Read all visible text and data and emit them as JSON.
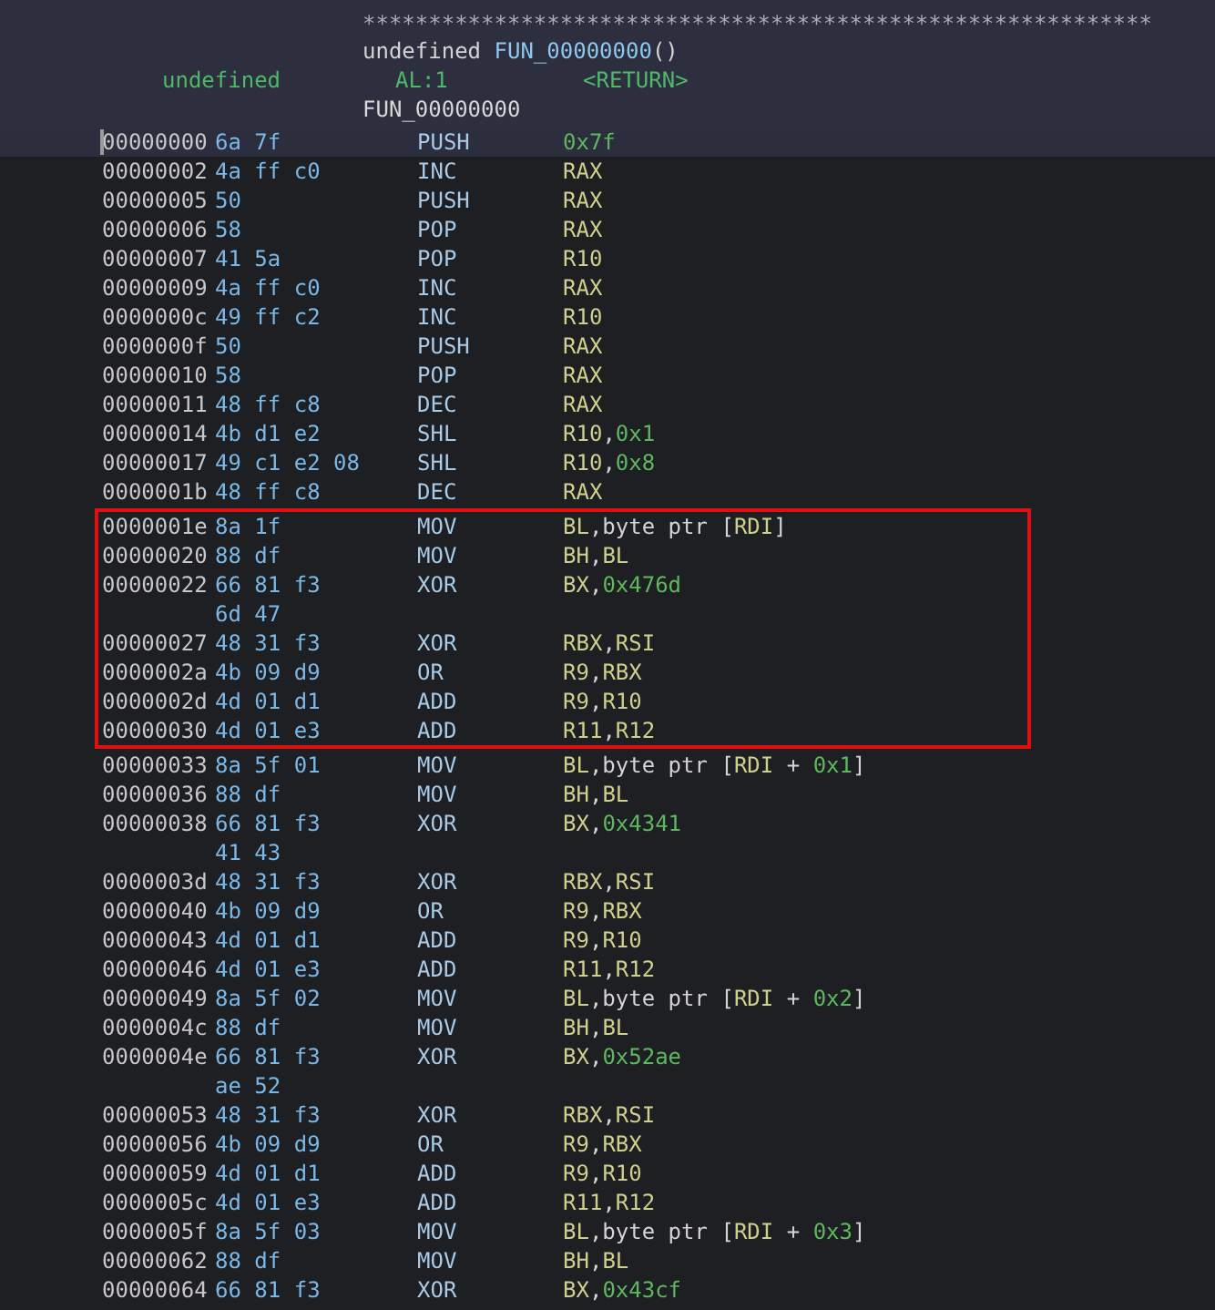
{
  "header": {
    "rule": "************************************************************",
    "signature": [
      {
        "t": "undefined ",
        "kind": "plain"
      },
      {
        "t": "FUN_00000000",
        "kind": "func"
      },
      {
        "t": "()",
        "kind": "plain"
      }
    ],
    "return_type": "undefined",
    "return_storage": "AL:1",
    "return_name": "<RETURN>",
    "label": "FUN_00000000"
  },
  "rows": [
    {
      "address": "00000000",
      "bytes": "6a 7f",
      "mnemonic": "PUSH",
      "operands": [
        {
          "t": "0x7f",
          "kind": "num"
        }
      ],
      "selected": true,
      "boxed": false
    },
    {
      "address": "00000002",
      "bytes": "4a ff c0",
      "mnemonic": "INC",
      "operands": [
        {
          "t": "RAX",
          "kind": "reg"
        }
      ],
      "selected": false,
      "boxed": false
    },
    {
      "address": "00000005",
      "bytes": "50",
      "mnemonic": "PUSH",
      "operands": [
        {
          "t": "RAX",
          "kind": "reg"
        }
      ],
      "selected": false,
      "boxed": false
    },
    {
      "address": "00000006",
      "bytes": "58",
      "mnemonic": "POP",
      "operands": [
        {
          "t": "RAX",
          "kind": "reg"
        }
      ],
      "selected": false,
      "boxed": false
    },
    {
      "address": "00000007",
      "bytes": "41 5a",
      "mnemonic": "POP",
      "operands": [
        {
          "t": "R10",
          "kind": "reg"
        }
      ],
      "selected": false,
      "boxed": false
    },
    {
      "address": "00000009",
      "bytes": "4a ff c0",
      "mnemonic": "INC",
      "operands": [
        {
          "t": "RAX",
          "kind": "reg"
        }
      ],
      "selected": false,
      "boxed": false
    },
    {
      "address": "0000000c",
      "bytes": "49 ff c2",
      "mnemonic": "INC",
      "operands": [
        {
          "t": "R10",
          "kind": "reg"
        }
      ],
      "selected": false,
      "boxed": false
    },
    {
      "address": "0000000f",
      "bytes": "50",
      "mnemonic": "PUSH",
      "operands": [
        {
          "t": "RAX",
          "kind": "reg"
        }
      ],
      "selected": false,
      "boxed": false
    },
    {
      "address": "00000010",
      "bytes": "58",
      "mnemonic": "POP",
      "operands": [
        {
          "t": "RAX",
          "kind": "reg"
        }
      ],
      "selected": false,
      "boxed": false
    },
    {
      "address": "00000011",
      "bytes": "48 ff c8",
      "mnemonic": "DEC",
      "operands": [
        {
          "t": "RAX",
          "kind": "reg"
        }
      ],
      "selected": false,
      "boxed": false
    },
    {
      "address": "00000014",
      "bytes": "4b d1 e2",
      "mnemonic": "SHL",
      "operands": [
        {
          "t": "R10",
          "kind": "reg"
        },
        {
          "t": ",",
          "kind": "plain"
        },
        {
          "t": "0x1",
          "kind": "num"
        }
      ],
      "selected": false,
      "boxed": false
    },
    {
      "address": "00000017",
      "bytes": "49 c1 e2 08",
      "mnemonic": "SHL",
      "operands": [
        {
          "t": "R10",
          "kind": "reg"
        },
        {
          "t": ",",
          "kind": "plain"
        },
        {
          "t": "0x8",
          "kind": "num"
        }
      ],
      "selected": false,
      "boxed": false
    },
    {
      "address": "0000001b",
      "bytes": "48 ff c8",
      "mnemonic": "DEC",
      "operands": [
        {
          "t": "RAX",
          "kind": "reg"
        }
      ],
      "selected": false,
      "boxed": false
    },
    {
      "address": "0000001e",
      "bytes": "8a 1f",
      "mnemonic": "MOV",
      "operands": [
        {
          "t": "BL",
          "kind": "reg"
        },
        {
          "t": ",byte ptr [",
          "kind": "plain"
        },
        {
          "t": "RDI",
          "kind": "reg"
        },
        {
          "t": "]",
          "kind": "plain"
        }
      ],
      "selected": false,
      "boxed": true
    },
    {
      "address": "00000020",
      "bytes": "88 df",
      "mnemonic": "MOV",
      "operands": [
        {
          "t": "BH",
          "kind": "reg"
        },
        {
          "t": ",",
          "kind": "plain"
        },
        {
          "t": "BL",
          "kind": "reg"
        }
      ],
      "selected": false,
      "boxed": true
    },
    {
      "address": "00000022",
      "bytes": "66 81 f3",
      "bytes_more": "6d 47",
      "mnemonic": "XOR",
      "operands": [
        {
          "t": "BX",
          "kind": "reg"
        },
        {
          "t": ",",
          "kind": "plain"
        },
        {
          "t": "0x476d",
          "kind": "num"
        }
      ],
      "selected": false,
      "boxed": true
    },
    {
      "address": "00000027",
      "bytes": "48 31 f3",
      "mnemonic": "XOR",
      "operands": [
        {
          "t": "RBX",
          "kind": "reg"
        },
        {
          "t": ",",
          "kind": "plain"
        },
        {
          "t": "RSI",
          "kind": "reg"
        }
      ],
      "selected": false,
      "boxed": true
    },
    {
      "address": "0000002a",
      "bytes": "4b 09 d9",
      "mnemonic": "OR",
      "operands": [
        {
          "t": "R9",
          "kind": "reg"
        },
        {
          "t": ",",
          "kind": "plain"
        },
        {
          "t": "RBX",
          "kind": "reg"
        }
      ],
      "selected": false,
      "boxed": true
    },
    {
      "address": "0000002d",
      "bytes": "4d 01 d1",
      "mnemonic": "ADD",
      "operands": [
        {
          "t": "R9",
          "kind": "reg"
        },
        {
          "t": ",",
          "kind": "plain"
        },
        {
          "t": "R10",
          "kind": "reg"
        }
      ],
      "selected": false,
      "boxed": true
    },
    {
      "address": "00000030",
      "bytes": "4d 01 e3",
      "mnemonic": "ADD",
      "operands": [
        {
          "t": "R11",
          "kind": "reg"
        },
        {
          "t": ",",
          "kind": "plain"
        },
        {
          "t": "R12",
          "kind": "reg"
        }
      ],
      "selected": false,
      "boxed": true
    },
    {
      "address": "00000033",
      "bytes": "8a 5f 01",
      "mnemonic": "MOV",
      "operands": [
        {
          "t": "BL",
          "kind": "reg"
        },
        {
          "t": ",byte ptr [",
          "kind": "plain"
        },
        {
          "t": "RDI",
          "kind": "reg"
        },
        {
          "t": " + ",
          "kind": "plain"
        },
        {
          "t": "0x1",
          "kind": "num"
        },
        {
          "t": "]",
          "kind": "plain"
        }
      ],
      "selected": false,
      "boxed": false
    },
    {
      "address": "00000036",
      "bytes": "88 df",
      "mnemonic": "MOV",
      "operands": [
        {
          "t": "BH",
          "kind": "reg"
        },
        {
          "t": ",",
          "kind": "plain"
        },
        {
          "t": "BL",
          "kind": "reg"
        }
      ],
      "selected": false,
      "boxed": false
    },
    {
      "address": "00000038",
      "bytes": "66 81 f3",
      "bytes_more": "41 43",
      "mnemonic": "XOR",
      "operands": [
        {
          "t": "BX",
          "kind": "reg"
        },
        {
          "t": ",",
          "kind": "plain"
        },
        {
          "t": "0x4341",
          "kind": "num"
        }
      ],
      "selected": false,
      "boxed": false
    },
    {
      "address": "0000003d",
      "bytes": "48 31 f3",
      "mnemonic": "XOR",
      "operands": [
        {
          "t": "RBX",
          "kind": "reg"
        },
        {
          "t": ",",
          "kind": "plain"
        },
        {
          "t": "RSI",
          "kind": "reg"
        }
      ],
      "selected": false,
      "boxed": false
    },
    {
      "address": "00000040",
      "bytes": "4b 09 d9",
      "mnemonic": "OR",
      "operands": [
        {
          "t": "R9",
          "kind": "reg"
        },
        {
          "t": ",",
          "kind": "plain"
        },
        {
          "t": "RBX",
          "kind": "reg"
        }
      ],
      "selected": false,
      "boxed": false
    },
    {
      "address": "00000043",
      "bytes": "4d 01 d1",
      "mnemonic": "ADD",
      "operands": [
        {
          "t": "R9",
          "kind": "reg"
        },
        {
          "t": ",",
          "kind": "plain"
        },
        {
          "t": "R10",
          "kind": "reg"
        }
      ],
      "selected": false,
      "boxed": false
    },
    {
      "address": "00000046",
      "bytes": "4d 01 e3",
      "mnemonic": "ADD",
      "operands": [
        {
          "t": "R11",
          "kind": "reg"
        },
        {
          "t": ",",
          "kind": "plain"
        },
        {
          "t": "R12",
          "kind": "reg"
        }
      ],
      "selected": false,
      "boxed": false
    },
    {
      "address": "00000049",
      "bytes": "8a 5f 02",
      "mnemonic": "MOV",
      "operands": [
        {
          "t": "BL",
          "kind": "reg"
        },
        {
          "t": ",byte ptr [",
          "kind": "plain"
        },
        {
          "t": "RDI",
          "kind": "reg"
        },
        {
          "t": " + ",
          "kind": "plain"
        },
        {
          "t": "0x2",
          "kind": "num"
        },
        {
          "t": "]",
          "kind": "plain"
        }
      ],
      "selected": false,
      "boxed": false
    },
    {
      "address": "0000004c",
      "bytes": "88 df",
      "mnemonic": "MOV",
      "operands": [
        {
          "t": "BH",
          "kind": "reg"
        },
        {
          "t": ",",
          "kind": "plain"
        },
        {
          "t": "BL",
          "kind": "reg"
        }
      ],
      "selected": false,
      "boxed": false
    },
    {
      "address": "0000004e",
      "bytes": "66 81 f3",
      "bytes_more": "ae 52",
      "mnemonic": "XOR",
      "operands": [
        {
          "t": "BX",
          "kind": "reg"
        },
        {
          "t": ",",
          "kind": "plain"
        },
        {
          "t": "0x52ae",
          "kind": "num"
        }
      ],
      "selected": false,
      "boxed": false
    },
    {
      "address": "00000053",
      "bytes": "48 31 f3",
      "mnemonic": "XOR",
      "operands": [
        {
          "t": "RBX",
          "kind": "reg"
        },
        {
          "t": ",",
          "kind": "plain"
        },
        {
          "t": "RSI",
          "kind": "reg"
        }
      ],
      "selected": false,
      "boxed": false
    },
    {
      "address": "00000056",
      "bytes": "4b 09 d9",
      "mnemonic": "OR",
      "operands": [
        {
          "t": "R9",
          "kind": "reg"
        },
        {
          "t": ",",
          "kind": "plain"
        },
        {
          "t": "RBX",
          "kind": "reg"
        }
      ],
      "selected": false,
      "boxed": false
    },
    {
      "address": "00000059",
      "bytes": "4d 01 d1",
      "mnemonic": "ADD",
      "operands": [
        {
          "t": "R9",
          "kind": "reg"
        },
        {
          "t": ",",
          "kind": "plain"
        },
        {
          "t": "R10",
          "kind": "reg"
        }
      ],
      "selected": false,
      "boxed": false
    },
    {
      "address": "0000005c",
      "bytes": "4d 01 e3",
      "mnemonic": "ADD",
      "operands": [
        {
          "t": "R11",
          "kind": "reg"
        },
        {
          "t": ",",
          "kind": "plain"
        },
        {
          "t": "R12",
          "kind": "reg"
        }
      ],
      "selected": false,
      "boxed": false
    },
    {
      "address": "0000005f",
      "bytes": "8a 5f 03",
      "mnemonic": "MOV",
      "operands": [
        {
          "t": "BL",
          "kind": "reg"
        },
        {
          "t": ",byte ptr [",
          "kind": "plain"
        },
        {
          "t": "RDI",
          "kind": "reg"
        },
        {
          "t": " + ",
          "kind": "plain"
        },
        {
          "t": "0x3",
          "kind": "num"
        },
        {
          "t": "]",
          "kind": "plain"
        }
      ],
      "selected": false,
      "boxed": false
    },
    {
      "address": "00000062",
      "bytes": "88 df",
      "mnemonic": "MOV",
      "operands": [
        {
          "t": "BH",
          "kind": "reg"
        },
        {
          "t": ",",
          "kind": "plain"
        },
        {
          "t": "BL",
          "kind": "reg"
        }
      ],
      "selected": false,
      "boxed": false
    },
    {
      "address": "00000064",
      "bytes": "66 81 f3",
      "mnemonic": "XOR",
      "operands": [
        {
          "t": "BX",
          "kind": "reg"
        },
        {
          "t": ",",
          "kind": "plain"
        },
        {
          "t": "0x43cf",
          "kind": "num"
        }
      ],
      "selected": false,
      "boxed": false
    }
  ]
}
